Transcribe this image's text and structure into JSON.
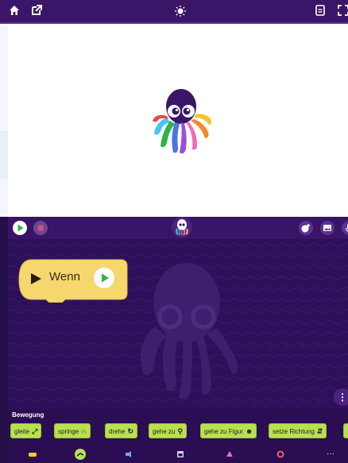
{
  "topbar": {
    "home_icon": "home-icon",
    "open_external_icon": "external-link-icon",
    "bulb_icon": "lightbulb-icon",
    "doc_icon": "document-icon",
    "fullscreen_icon": "fullscreen-icon"
  },
  "colors": {
    "topbar": "#3b1668",
    "workspace": "#2e0f59",
    "block_motion": "#b8e24a",
    "block_event": "#f5d76e",
    "green_flag": "#2fb24a",
    "stop": "#d64b83"
  },
  "workspace": {
    "wenn_label": "Wenn"
  },
  "palette": {
    "category_title": "Bewegung",
    "blocks": [
      {
        "label": "gleite",
        "icon": "⤢"
      },
      {
        "label": "springe",
        "icon": "∩"
      },
      {
        "label": "drehe",
        "icon": "↻"
      },
      {
        "label": "gehe zu",
        "icon": "⚲"
      },
      {
        "label": "gehe zu Figur",
        "icon": "☻"
      },
      {
        "label": "setze Richtung",
        "icon": "⇵"
      }
    ],
    "more_label": "⋮"
  },
  "categories": {
    "more_label": "···"
  }
}
